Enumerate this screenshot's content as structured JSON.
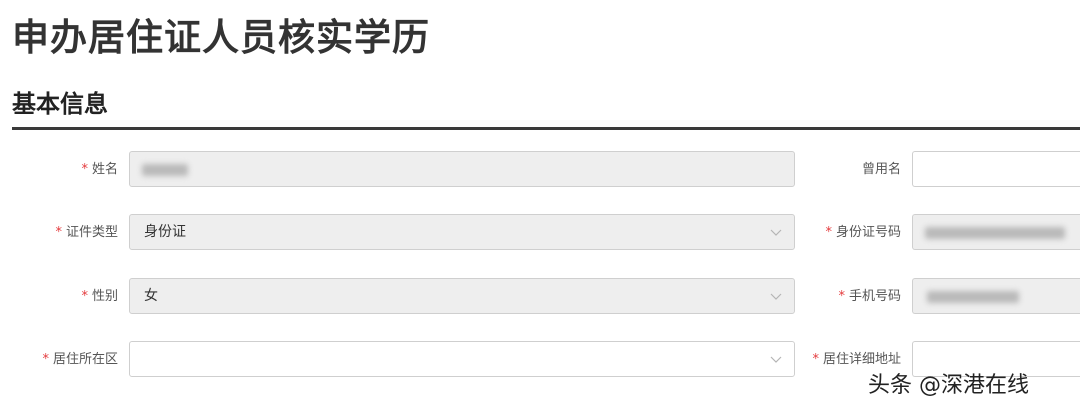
{
  "page": {
    "title": "申办居住证人员核实学历"
  },
  "section": {
    "title": "基本信息"
  },
  "required_mark": "*",
  "form": {
    "name": {
      "label": "姓名",
      "value": ""
    },
    "former_name": {
      "label": "曾用名",
      "value": ""
    },
    "id_type": {
      "label": "证件类型",
      "value": "身份证"
    },
    "id_number": {
      "label": "身份证号码",
      "value": ""
    },
    "gender": {
      "label": "性别",
      "value": "女"
    },
    "phone": {
      "label": "手机号码",
      "value": ""
    },
    "district": {
      "label": "居住所在区",
      "value": ""
    },
    "address": {
      "label": "居住详细地址",
      "value": ""
    }
  },
  "watermark": {
    "text": "头条 @深港在线"
  },
  "icons": {
    "dropdown": "chevron-down-icon"
  },
  "colors": {
    "required": "#e4393c",
    "disabled_bg": "#eeeeee",
    "border": "#cfcfcf"
  }
}
